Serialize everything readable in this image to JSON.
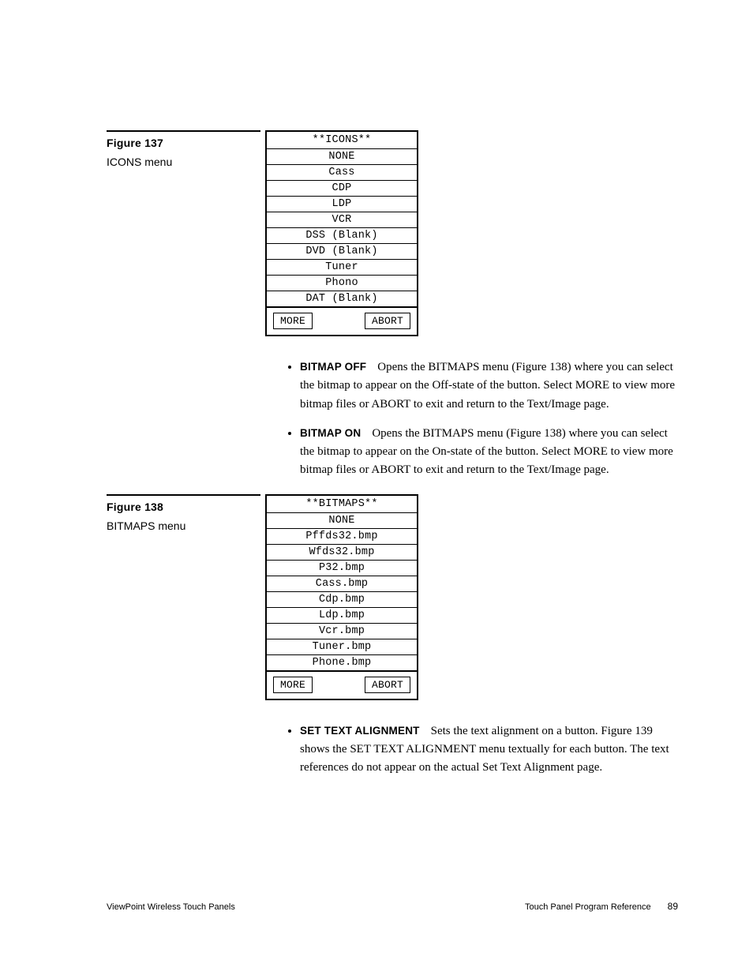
{
  "figure137": {
    "label": "Figure 137",
    "desc": "ICONS menu",
    "menu_title": "**ICONS**",
    "items": [
      "NONE",
      "Cass",
      "CDP",
      "LDP",
      "VCR",
      "DSS (Blank)",
      "DVD (Blank)",
      "Tuner",
      "Phono",
      "DAT (Blank)"
    ],
    "more": "MORE",
    "abort": "ABORT"
  },
  "bullets1": {
    "b1_term": "BITMAP OFF",
    "b1_text": "Opens the BITMAPS menu (Figure 138) where you can select the bitmap to appear on the Off-state of the button. Select MORE to view more bitmap files or ABORT to exit and return to the Text/Image page.",
    "b2_term": "BITMAP ON",
    "b2_text": "Opens the BITMAPS menu (Figure 138) where you can select the bitmap to appear on the On-state of the button. Select MORE to view more bitmap files or ABORT to exit and return to the Text/Image page."
  },
  "figure138": {
    "label": "Figure 138",
    "desc": "BITMAPS menu",
    "menu_title": "**BITMAPS**",
    "items": [
      "NONE",
      "Pffds32.bmp",
      "Wfds32.bmp",
      "P32.bmp",
      "Cass.bmp",
      "Cdp.bmp",
      "Ldp.bmp",
      "Vcr.bmp",
      "Tuner.bmp",
      "Phone.bmp"
    ],
    "more": "MORE",
    "abort": "ABORT"
  },
  "bullets2": {
    "b1_term": "SET TEXT ALIGNMENT",
    "b1_text": "Sets the text alignment on a button. Figure 139 shows the SET TEXT ALIGNMENT menu textually for each button. The text references do not appear on the actual Set Text Alignment page."
  },
  "footer": {
    "left": "ViewPoint Wireless Touch Panels",
    "right": "Touch Panel Program Reference",
    "page": "89"
  }
}
